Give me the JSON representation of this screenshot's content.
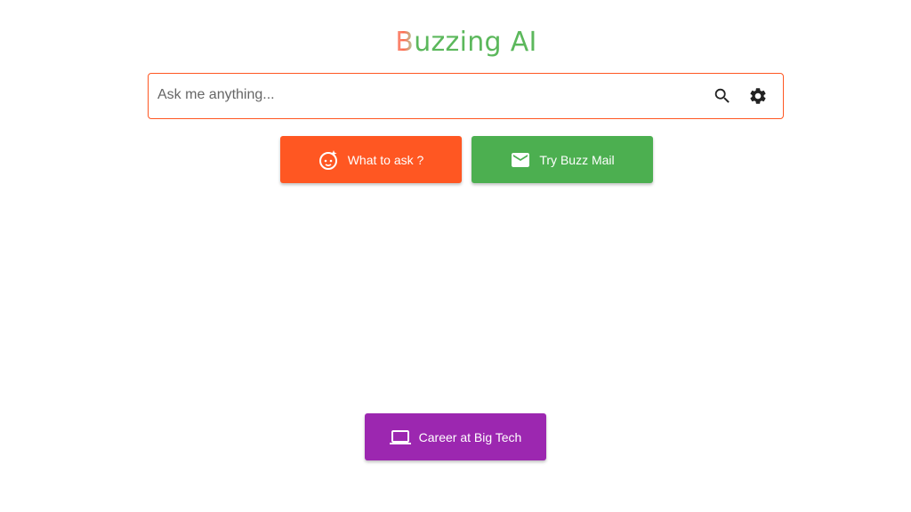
{
  "logo": {
    "first_letter": "B",
    "rest": "uzzing AI"
  },
  "search": {
    "placeholder": "Ask me anything...",
    "value": ""
  },
  "buttons": {
    "what_to_ask": "What to ask ?",
    "try_buzz_mail": "Try Buzz Mail",
    "career": "Career at Big Tech"
  },
  "icons": {
    "search": "search-icon",
    "settings": "gear-icon",
    "ask": "baby-face-icon",
    "mail": "mail-icon",
    "career": "laptop-icon"
  },
  "colors": {
    "brand_green": "#5cb85c",
    "accent_orange": "#ff5722",
    "mail_green": "#4caf50",
    "career_purple": "#9c27b0"
  }
}
